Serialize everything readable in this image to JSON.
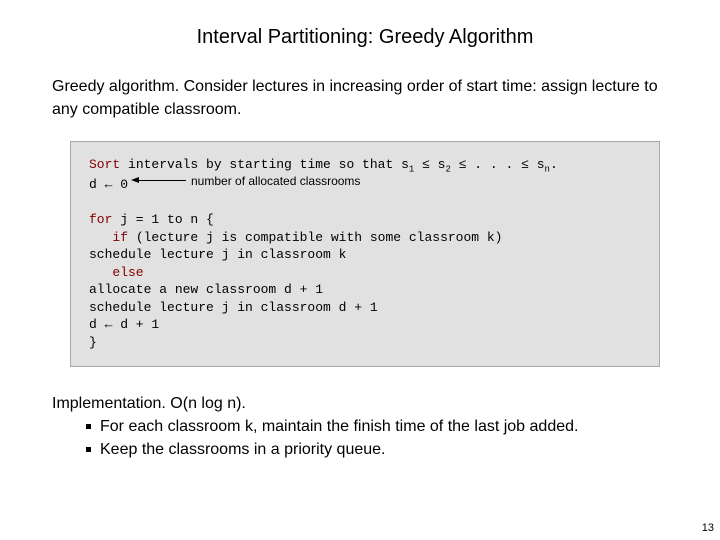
{
  "title": "Interval Partitioning: Greedy Algorithm",
  "para": {
    "lead": "Greedy algorithm.",
    "body": "  Consider lectures in increasing order of start time: assign lecture to any compatible classroom."
  },
  "code": {
    "kw_sort": "Sort",
    "line1_a": " intervals by starting time so that s",
    "line1_b": " ≤ s",
    "line1_c": " ≤ . . . ≤ s",
    "line1_dot": ".",
    "sub1": "1",
    "sub2": "2",
    "subn": "n",
    "line2": "d ← 0",
    "kw_for": "for",
    "line3_a": " j = 1 to n {",
    "kw_if": "if",
    "line4_a": " (lecture j is compatible with some classroom k)",
    "line5": "      schedule lecture j in classroom k",
    "kw_else": "else",
    "line7": "      allocate a new classroom d + 1",
    "line8": "      schedule lecture j in classroom d + 1",
    "line9": "      d ← d + 1",
    "line10": "}",
    "annotation": "number of allocated classrooms"
  },
  "impl": {
    "lead": "Implementation.",
    "body": "  O(n log n).",
    "bullet1": "For each classroom k, maintain the finish time of the last job added.",
    "bullet2": "Keep the classrooms in a priority queue."
  },
  "pagenum": "13"
}
